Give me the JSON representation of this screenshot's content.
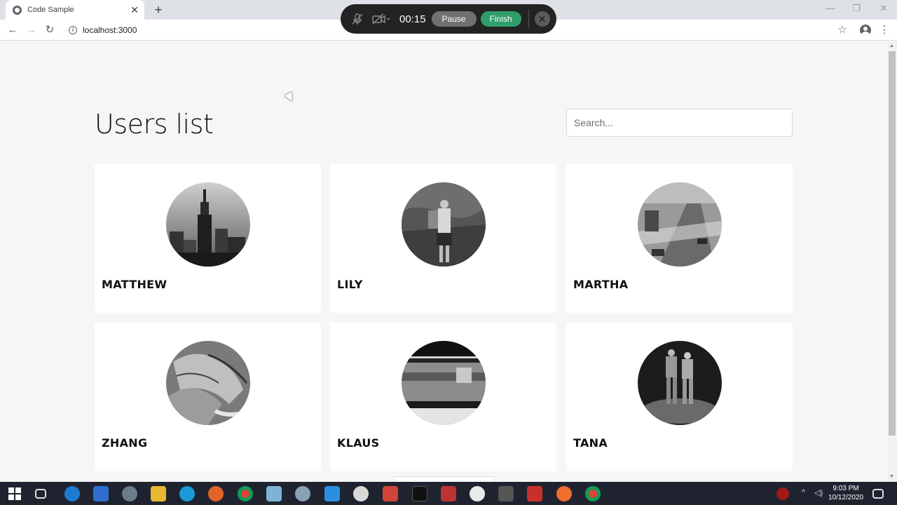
{
  "browser": {
    "tab_title": "Code Sample",
    "tab_close": "✕",
    "new_tab": "+",
    "url": "localhost:3000",
    "info_icon": "i",
    "back": "←",
    "forward": "→",
    "reload": "↻",
    "bookmark": "☆",
    "menu": "⋮",
    "minimize": "—",
    "restore": "❐",
    "close": "✕"
  },
  "recorder": {
    "timer": "00:15",
    "pause_label": "Pause",
    "finish_label": "Finish",
    "close": "✕"
  },
  "page": {
    "title": "Users list",
    "search_placeholder": "Search..."
  },
  "users": [
    {
      "name": "MATTHEW"
    },
    {
      "name": "LILY"
    },
    {
      "name": "MARTHA"
    },
    {
      "name": "ZHANG"
    },
    {
      "name": "KLAUS"
    },
    {
      "name": "TANA"
    }
  ],
  "taskbar": {
    "time": "9:03 PM",
    "date": "10/12/2020"
  },
  "colors": {
    "page_bg": "#f6f6f5",
    "finish_green": "#2f9e6b",
    "taskbar_bg": "#1f2330"
  }
}
